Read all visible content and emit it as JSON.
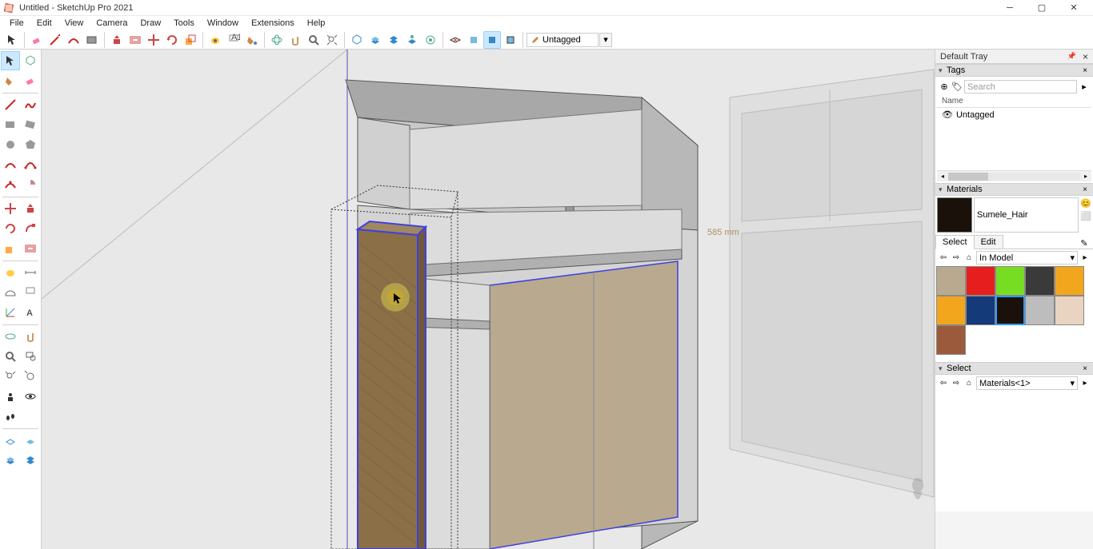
{
  "window": {
    "title": "Untitled - SketchUp Pro 2021"
  },
  "menubar": {
    "items": [
      "File",
      "Edit",
      "View",
      "Camera",
      "Draw",
      "Tools",
      "Window",
      "Extensions",
      "Help"
    ]
  },
  "top_toolbar": {
    "tag_field": "Untagged"
  },
  "tray": {
    "title": "Default Tray",
    "tags": {
      "title": "Tags",
      "search_placeholder": "Search",
      "header": "Name",
      "item0": "Untagged"
    },
    "materials": {
      "title": "Materials",
      "current_name": "Sumele_Hair",
      "tab_select": "Select",
      "tab_edit": "Edit",
      "library": "In Model",
      "swatches": [
        {
          "c": "#b9aa8f"
        },
        {
          "c": "#e61e1e"
        },
        {
          "c": "#77dd22"
        },
        {
          "c": "#3a3a3a"
        },
        {
          "c": "#f2a61e"
        },
        {
          "c": "#f2a61e"
        },
        {
          "c": "#153a7a"
        },
        {
          "c": "#1a120a",
          "selected": true
        },
        {
          "c": "#bdbdbd"
        },
        {
          "c": "#e8d4c0"
        },
        {
          "c": "#9c5a3c"
        }
      ]
    },
    "select": {
      "title": "Select",
      "library": "Materials<1>"
    }
  },
  "viewport": {
    "dimension_label": "585 mm"
  }
}
